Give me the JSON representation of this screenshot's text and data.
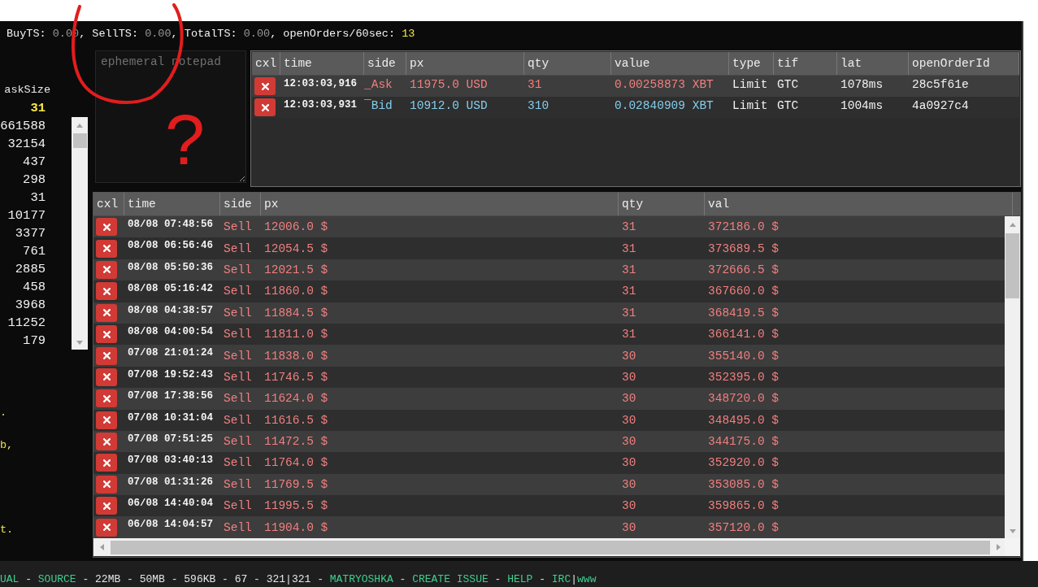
{
  "stats_bar": {
    "items": [
      {
        "label": "BuyTS:",
        "value": "0.00",
        "highlight": false,
        "separator": ","
      },
      {
        "label": "SellTS:",
        "value": "0.00",
        "highlight": false,
        "separator": ","
      },
      {
        "label": "TotalTS:",
        "value": "0.00",
        "highlight": false,
        "separator": ","
      },
      {
        "label": "openOrders/60sec:",
        "value": "13",
        "highlight": true
      }
    ]
  },
  "order_book": {
    "column": "askSize",
    "rows": [
      {
        "value": "31",
        "highlighted": true
      },
      {
        "value": "661588",
        "highlighted": false
      },
      {
        "value": "32154",
        "highlighted": false
      },
      {
        "value": "437",
        "highlighted": false
      },
      {
        "value": "298",
        "highlighted": false
      },
      {
        "value": "31",
        "highlighted": false
      },
      {
        "value": "10177",
        "highlighted": false
      },
      {
        "value": "3377",
        "highlighted": false
      },
      {
        "value": "761",
        "highlighted": false
      },
      {
        "value": "2885",
        "highlighted": false
      },
      {
        "value": "458",
        "highlighted": false
      },
      {
        "value": "3968",
        "highlighted": false
      },
      {
        "value": "11252",
        "highlighted": false
      },
      {
        "value": "179",
        "highlighted": false
      }
    ]
  },
  "notes": [
    ".",
    "b,",
    "t."
  ],
  "notepad": {
    "placeholder": "ephemeral notepad"
  },
  "open_orders": {
    "columns": [
      "cxl",
      "time",
      "side",
      "px",
      "qty",
      "value",
      "type",
      "tif",
      "lat",
      "openOrderId"
    ],
    "rows": [
      {
        "kind": "ask",
        "time": "12:03:03,916",
        "side": "_Ask",
        "px": "11975.0 USD",
        "qty": "31",
        "value": "0.00258873 XBT",
        "type": "Limit",
        "tif": "GTC",
        "lat": "1078ms",
        "order_id": "28c5f61e"
      },
      {
        "kind": "bid",
        "time": "12:03:03,931",
        "side": "¯Bid",
        "px": "10912.0 USD",
        "qty": "310",
        "value": "0.02840909 XBT",
        "type": "Limit",
        "tif": "GTC",
        "lat": "1004ms",
        "order_id": "4a0927c4"
      }
    ]
  },
  "history": {
    "columns": [
      "cxl",
      "time",
      "side",
      "px",
      "qty",
      "val"
    ],
    "rows": [
      {
        "kind": "sell",
        "time": "08/08 07:48:56",
        "side": "Sell",
        "px": "12006.0 $",
        "qty": "31",
        "val": "372186.0 $"
      },
      {
        "kind": "sell",
        "time": "08/08 06:56:46",
        "side": "Sell",
        "px": "12054.5 $",
        "qty": "31",
        "val": "373689.5 $"
      },
      {
        "kind": "sell",
        "time": "08/08 05:50:36",
        "side": "Sell",
        "px": "12021.5 $",
        "qty": "31",
        "val": "372666.5 $"
      },
      {
        "kind": "sell",
        "time": "08/08 05:16:42",
        "side": "Sell",
        "px": "11860.0 $",
        "qty": "31",
        "val": "367660.0 $"
      },
      {
        "kind": "sell",
        "time": "08/08 04:38:57",
        "side": "Sell",
        "px": "11884.5 $",
        "qty": "31",
        "val": "368419.5 $"
      },
      {
        "kind": "sell",
        "time": "08/08 04:00:54",
        "side": "Sell",
        "px": "11811.0 $",
        "qty": "31",
        "val": "366141.0 $"
      },
      {
        "kind": "sell",
        "time": "07/08 21:01:24",
        "side": "Sell",
        "px": "11838.0 $",
        "qty": "30",
        "val": "355140.0 $"
      },
      {
        "kind": "sell",
        "time": "07/08 19:52:43",
        "side": "Sell",
        "px": "11746.5 $",
        "qty": "30",
        "val": "352395.0 $"
      },
      {
        "kind": "sell",
        "time": "07/08 17:38:56",
        "side": "Sell",
        "px": "11624.0 $",
        "qty": "30",
        "val": "348720.0 $"
      },
      {
        "kind": "sell",
        "time": "07/08 10:31:04",
        "side": "Sell",
        "px": "11616.5 $",
        "qty": "30",
        "val": "348495.0 $"
      },
      {
        "kind": "sell",
        "time": "07/08 07:51:25",
        "side": "Sell",
        "px": "11472.5 $",
        "qty": "30",
        "val": "344175.0 $"
      },
      {
        "kind": "sell",
        "time": "07/08 03:40:13",
        "side": "Sell",
        "px": "11764.0 $",
        "qty": "30",
        "val": "352920.0 $"
      },
      {
        "kind": "sell",
        "time": "07/08 01:31:26",
        "side": "Sell",
        "px": "11769.5 $",
        "qty": "30",
        "val": "353085.0 $"
      },
      {
        "kind": "sell",
        "time": "06/08 14:40:04",
        "side": "Sell",
        "px": "11995.5 $",
        "qty": "30",
        "val": "359865.0 $"
      },
      {
        "kind": "sell",
        "time": "06/08 14:04:57",
        "side": "Sell",
        "px": "11904.0 $",
        "qty": "30",
        "val": "357120.0 $"
      }
    ]
  },
  "footer": {
    "items": [
      {
        "text": "UAL",
        "kind": "link",
        "separator": " - "
      },
      {
        "text": "SOURCE",
        "kind": "link",
        "separator": " - "
      },
      {
        "text": "22MB",
        "kind": "info",
        "separator": " - "
      },
      {
        "text": "50MB",
        "kind": "info",
        "separator": " - "
      },
      {
        "text": "596KB",
        "kind": "info",
        "separator": " - "
      },
      {
        "text": "67",
        "kind": "info",
        "separator": " - "
      },
      {
        "text": "321|321",
        "kind": "info",
        "separator": " - "
      },
      {
        "text": "MATRYOSHKA",
        "kind": "link",
        "separator": " - "
      },
      {
        "text": "CREATE ISSUE",
        "kind": "link",
        "separator": " - "
      },
      {
        "text": "HELP",
        "kind": "link",
        "separator": " - "
      },
      {
        "text": "IRC",
        "kind": "link",
        "separator": "|"
      },
      {
        "text": "www",
        "kind": "link"
      }
    ]
  },
  "annotation": {
    "circle": true,
    "mark": "?"
  }
}
